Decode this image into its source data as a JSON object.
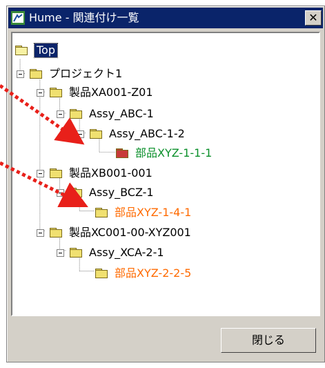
{
  "window": {
    "title": "Hume - 関連付け一覧",
    "close_glyph": "✕",
    "close_button_label": "閉じる"
  },
  "tree": {
    "root": "Top",
    "project": "プロジェクト1",
    "products": [
      {
        "label": "製品XA001-Z01",
        "assy": "Assy_ABC-1",
        "sub_assy": "Assy_ABC-1-2",
        "part": "部品XYZ-1-1-1",
        "part_color": "#0a8f2a",
        "part_icon": "folder-red-icon"
      },
      {
        "label": "製品XB001-001",
        "assy": "Assy_BCZ-1",
        "part": "部品XYZ-1-4-1",
        "part_color": "#ff6a00",
        "part_icon": "folder-icon"
      },
      {
        "label": "製品XC001-00-XYZ001",
        "assy": "Assy_XCA-2-1",
        "part": "部品XYZ-2-2-5",
        "part_color": "#ff6a00",
        "part_icon": "folder-icon"
      }
    ]
  },
  "colors": {
    "title_bar": "#0a246a",
    "annotation_arrows": "#e8201a"
  }
}
